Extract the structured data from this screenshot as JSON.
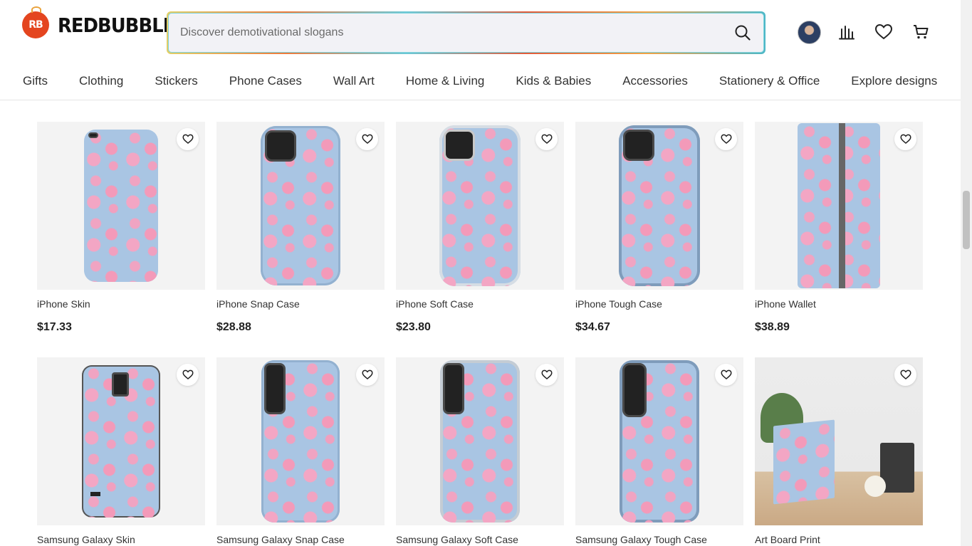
{
  "brand": {
    "name": "REDBUBBLE",
    "mark": "RB"
  },
  "search": {
    "placeholder": "Discover demotivational slogans"
  },
  "header_icons": [
    "avatar",
    "bar-chart-icon",
    "heart-icon",
    "cart-icon"
  ],
  "nav": [
    {
      "label": "Gifts"
    },
    {
      "label": "Clothing"
    },
    {
      "label": "Stickers"
    },
    {
      "label": "Phone Cases"
    },
    {
      "label": "Wall Art"
    },
    {
      "label": "Home & Living"
    },
    {
      "label": "Kids & Babies"
    },
    {
      "label": "Accessories"
    },
    {
      "label": "Stationery & Office"
    },
    {
      "label": "Explore designs"
    }
  ],
  "products": [
    {
      "title": "iPhone Skin",
      "price": "$17.33"
    },
    {
      "title": "iPhone Snap Case",
      "price": "$28.88"
    },
    {
      "title": "iPhone Soft Case",
      "price": "$23.80"
    },
    {
      "title": "iPhone Tough Case",
      "price": "$34.67"
    },
    {
      "title": "iPhone Wallet",
      "price": "$38.89"
    },
    {
      "title": "Samsung Galaxy Skin"
    },
    {
      "title": "Samsung Galaxy Snap Case"
    },
    {
      "title": "Samsung Galaxy Soft Case"
    },
    {
      "title": "Samsung Galaxy Tough Case"
    },
    {
      "title": "Art Board Print"
    }
  ],
  "colors": {
    "brand": "#e4451f",
    "case_blue": "#a9c5e3",
    "pattern_pink": "#f0a4c2"
  }
}
